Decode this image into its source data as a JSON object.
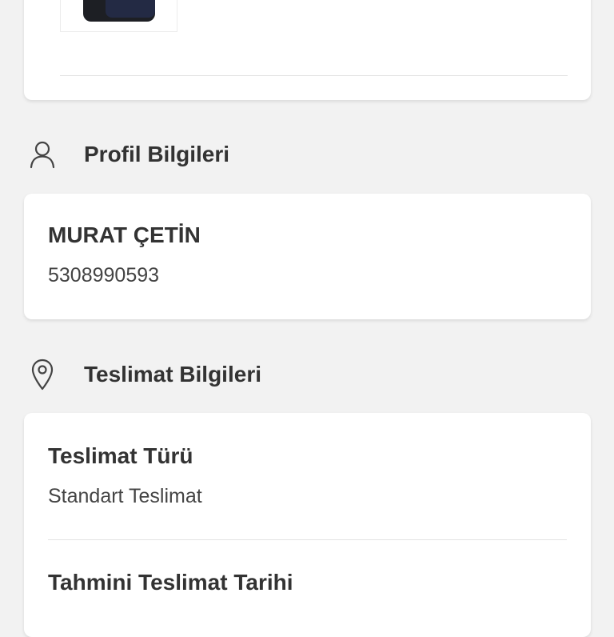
{
  "order": {
    "delivery_type_text": "Standart Teslimat"
  },
  "profile": {
    "section_title": "Profil Bilgileri",
    "section_icon": "user-icon",
    "name": "MURAT ÇETİN",
    "phone": "5308990593"
  },
  "delivery": {
    "section_title": "Teslimat Bilgileri",
    "section_icon": "location-pin-icon",
    "type_label": "Teslimat Türü",
    "type_value": "Standart Teslimat",
    "date_label": "Tahmini Teslimat Tarihi"
  },
  "colors": {
    "background": "#f2f2f2",
    "card": "#ffffff",
    "text_primary": "#333333",
    "text_muted": "#9a9a9a",
    "divider": "#e3e3e3"
  }
}
